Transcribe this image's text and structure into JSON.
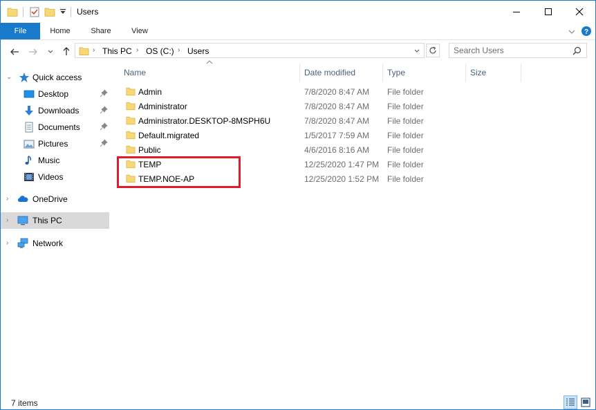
{
  "window": {
    "title": "Users"
  },
  "ribbon": {
    "tabs": [
      {
        "label": "File"
      },
      {
        "label": "Home"
      },
      {
        "label": "Share"
      },
      {
        "label": "View"
      }
    ]
  },
  "address": {
    "crumbs": [
      "This PC",
      "OS (C:)",
      "Users"
    ]
  },
  "search": {
    "placeholder": "Search Users"
  },
  "nav": {
    "items": [
      {
        "label": "Quick access"
      },
      {
        "label": "Desktop"
      },
      {
        "label": "Downloads"
      },
      {
        "label": "Documents"
      },
      {
        "label": "Pictures"
      },
      {
        "label": "Music"
      },
      {
        "label": "Videos"
      },
      {
        "label": "OneDrive"
      },
      {
        "label": "This PC"
      },
      {
        "label": "Network"
      }
    ]
  },
  "columns": {
    "name": "Name",
    "date": "Date modified",
    "type": "Type",
    "size": "Size"
  },
  "files": [
    {
      "name": "Admin",
      "date": "7/8/2020 8:47 AM",
      "type": "File folder",
      "size": ""
    },
    {
      "name": "Administrator",
      "date": "7/8/2020 8:47 AM",
      "type": "File folder",
      "size": ""
    },
    {
      "name": "Administrator.DESKTOP-8MSPH6U",
      "date": "7/8/2020 8:47 AM",
      "type": "File folder",
      "size": ""
    },
    {
      "name": "Default.migrated",
      "date": "1/5/2017 7:59 AM",
      "type": "File folder",
      "size": ""
    },
    {
      "name": "Public",
      "date": "4/6/2016 8:16 AM",
      "type": "File folder",
      "size": ""
    },
    {
      "name": "TEMP",
      "date": "12/25/2020 1:47 PM",
      "type": "File folder",
      "size": ""
    },
    {
      "name": "TEMP.NOE-AP",
      "date": "12/25/2020 1:52 PM",
      "type": "File folder",
      "size": ""
    }
  ],
  "status": {
    "count": "7 items"
  },
  "colors": {
    "accent": "#1979ca",
    "highlight": "#e21b2a",
    "folder": "#f8d775",
    "selected_nav": "#d9d9d9"
  }
}
